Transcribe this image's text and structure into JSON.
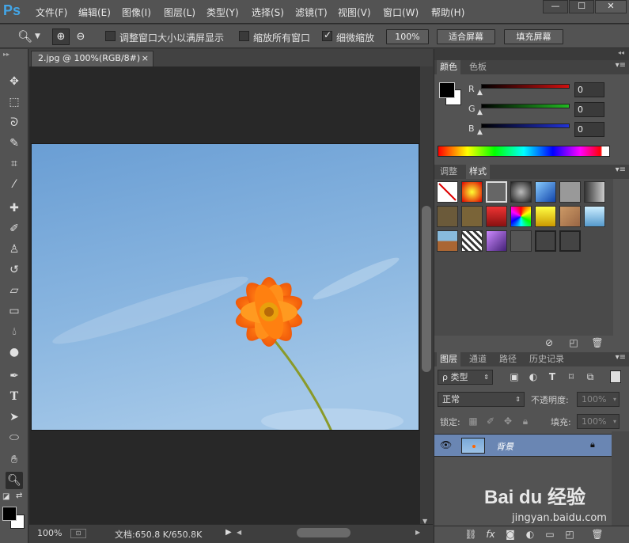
{
  "app": {
    "logo": "Ps"
  },
  "menu": [
    "文件(F)",
    "编辑(E)",
    "图像(I)",
    "图层(L)",
    "类型(Y)",
    "选择(S)",
    "滤镜(T)",
    "视图(V)",
    "窗口(W)",
    "帮助(H)"
  ],
  "window_controls": {
    "minimize": "—",
    "maximize": "☐",
    "close": "✕"
  },
  "options": {
    "resize_windows": {
      "label": "调整窗口大小以满屏显示",
      "checked": false
    },
    "zoom_all": {
      "label": "缩放所有窗口",
      "checked": false
    },
    "scrubby_zoom": {
      "label": "细微缩放",
      "checked": true
    },
    "btn_100": "100%",
    "btn_fit": "适合屏幕",
    "btn_fill": "填充屏幕"
  },
  "document": {
    "tab_title": "2.jpg @ 100%(RGB/8#)",
    "tab_close": "×",
    "zoom": "100%",
    "doc_size": "文档:650.8 K/650.8K"
  },
  "color_panel": {
    "tabs": [
      "颜色",
      "色板"
    ],
    "channels": [
      {
        "label": "R",
        "value": "0",
        "color": "#cc1111"
      },
      {
        "label": "G",
        "value": "0",
        "color": "#22aa22"
      },
      {
        "label": "B",
        "value": "0",
        "color": "#2233cc"
      }
    ]
  },
  "styles_panel": {
    "tabs": [
      "调整",
      "样式"
    ]
  },
  "layers_panel": {
    "tabs": [
      "图层",
      "通道",
      "路径",
      "历史记录"
    ],
    "filter_kind": "ρ 类型",
    "blend_mode": "正常",
    "opacity_label": "不透明度:",
    "opacity_value": "100%",
    "lock_label": "锁定:",
    "fill_label": "填充:",
    "fill_value": "100%",
    "layer_name": "背景"
  },
  "watermark": {
    "brand": "Bai du 经验",
    "url": "jingyan.baidu.com"
  }
}
